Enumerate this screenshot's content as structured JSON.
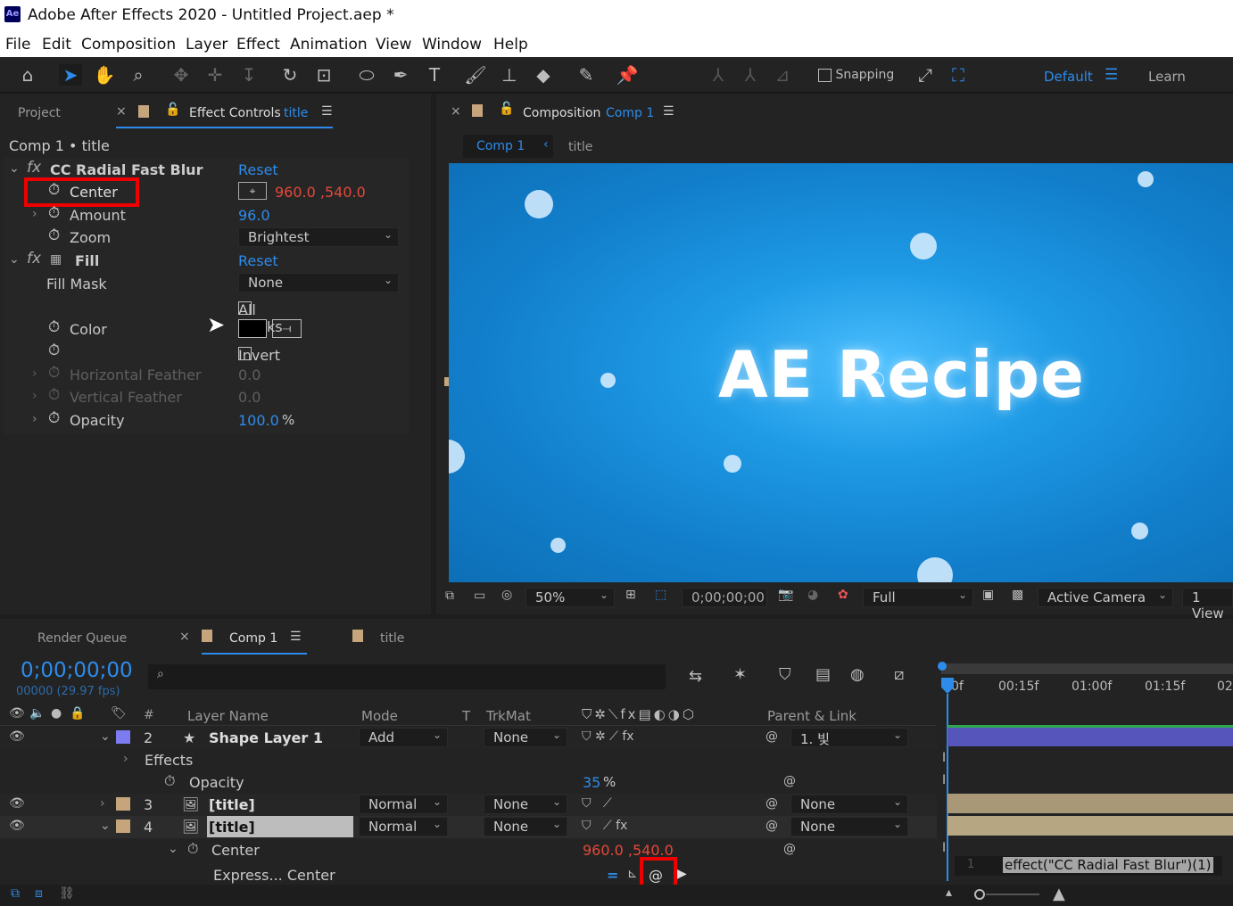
{
  "app": {
    "logo": "Ae",
    "title": "Adobe After Effects 2020 - Untitled Project.aep *"
  },
  "menu": [
    "File",
    "Edit",
    "Composition",
    "Layer",
    "Effect",
    "Animation",
    "View",
    "Window",
    "Help"
  ],
  "toolbar": {
    "snapping": "Snapping",
    "workspace": "Default",
    "learn": "Learn"
  },
  "left_panel": {
    "tab_project": "Project",
    "tab_effect_controls": "Effect Controls",
    "tab_effect_layer": "title",
    "breadcrumb": "Comp 1 • title",
    "effects": [
      {
        "name": "CC Radial Fast Blur",
        "reset": "Reset"
      },
      {
        "name": "Fill",
        "reset": "Reset"
      }
    ],
    "center": {
      "label": "Center",
      "value": "960.0 ,540.0"
    },
    "amount": {
      "label": "Amount",
      "value": "96.0"
    },
    "zoom": {
      "label": "Zoom",
      "value": "Brightest"
    },
    "fill_mask": {
      "label": "Fill Mask",
      "value": "None"
    },
    "all_masks": "All Masks",
    "color": {
      "label": "Color"
    },
    "invert": "Invert",
    "h_feather": {
      "label": "Horizontal Feather",
      "value": "0.0"
    },
    "v_feather": {
      "label": "Vertical Feather",
      "value": "0.0"
    },
    "opacity": {
      "label": "Opacity",
      "value": "100.0",
      "unit": "%"
    }
  },
  "comp_panel": {
    "tab": "Composition",
    "tab_name": "Comp 1",
    "crumb_comp": "Comp 1",
    "crumb_layer": "title",
    "canvas_text": "AE Recipe",
    "zoom": "50%",
    "timecode": "0;00;00;00",
    "resolution": "Full",
    "camera": "Active Camera",
    "views": "1 View"
  },
  "timeline": {
    "tab_render": "Render Queue",
    "tab_comp": "Comp 1",
    "tab_title": "title",
    "timecode": "0;00;00;00",
    "frames": "00000 (29.97 fps)",
    "ruler": [
      "0f",
      "00:15f",
      "01:00f",
      "01:15f",
      "02"
    ],
    "headers": {
      "num": "#",
      "name": "Layer Name",
      "mode": "Mode",
      "t": "T",
      "trkmat": "TrkMat",
      "parent": "Parent & Link"
    },
    "layers": [
      {
        "num": "2",
        "name": "Shape Layer 1",
        "mode": "Add",
        "trkmat": "None",
        "parent": "1. 빛"
      },
      {
        "num": "3",
        "name": "[title]",
        "mode": "Normal",
        "trkmat": "None",
        "parent": "None"
      },
      {
        "num": "4",
        "name": "[title]",
        "mode": "Normal",
        "trkmat": "None",
        "parent": "None"
      }
    ],
    "effects_label": "Effects",
    "opacity": {
      "label": "Opacity",
      "value": "35",
      "unit": "%"
    },
    "center": {
      "label": "Center",
      "value": "960.0 ,540.0"
    },
    "expression": {
      "label": "Express... Center",
      "line": "1",
      "code": "effect(\"CC Radial Fast Blur\")(1)"
    }
  },
  "colors": {
    "accent": "#2d8ceb",
    "highlight": "#e00000",
    "value_red": "#e5483a",
    "label_tan": "#c7a57c",
    "label_purple": "#7c7cf0"
  }
}
